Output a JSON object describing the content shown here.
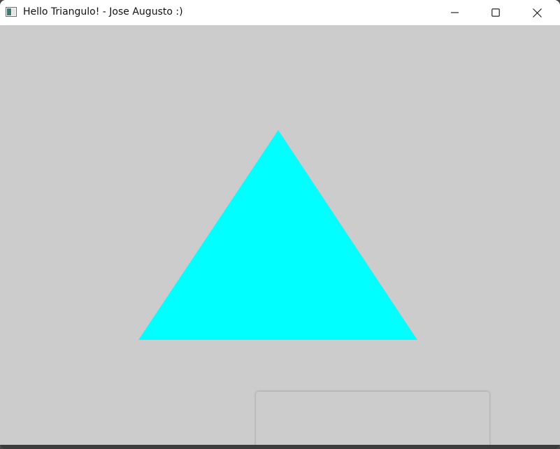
{
  "window": {
    "title": "Hello Triangulo! - Jose Augusto :)",
    "background_color": "#cccccc",
    "titlebar_color": "#ffffff"
  },
  "caption_buttons": {
    "minimize_icon": "minimize-icon",
    "maximize_icon": "maximize-icon",
    "close_icon": "close-icon"
  },
  "scene": {
    "shape": "triangle",
    "fill_color": "#00ffff"
  }
}
